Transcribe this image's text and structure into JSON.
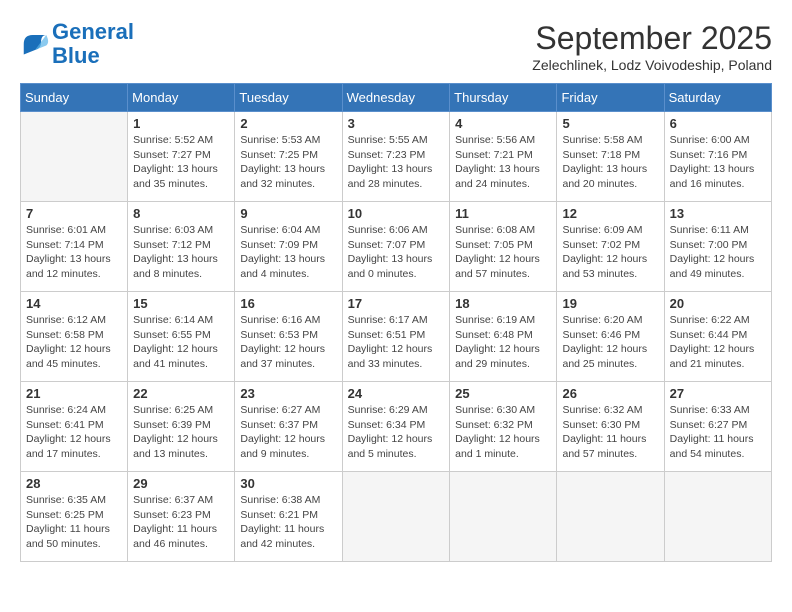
{
  "header": {
    "logo_line1": "General",
    "logo_line2": "Blue",
    "month": "September 2025",
    "location": "Zelechlinek, Lodz Voivodeship, Poland"
  },
  "days_of_week": [
    "Sunday",
    "Monday",
    "Tuesday",
    "Wednesday",
    "Thursday",
    "Friday",
    "Saturday"
  ],
  "weeks": [
    [
      {
        "day": "",
        "info": ""
      },
      {
        "day": "1",
        "info": "Sunrise: 5:52 AM\nSunset: 7:27 PM\nDaylight: 13 hours\nand 35 minutes."
      },
      {
        "day": "2",
        "info": "Sunrise: 5:53 AM\nSunset: 7:25 PM\nDaylight: 13 hours\nand 32 minutes."
      },
      {
        "day": "3",
        "info": "Sunrise: 5:55 AM\nSunset: 7:23 PM\nDaylight: 13 hours\nand 28 minutes."
      },
      {
        "day": "4",
        "info": "Sunrise: 5:56 AM\nSunset: 7:21 PM\nDaylight: 13 hours\nand 24 minutes."
      },
      {
        "day": "5",
        "info": "Sunrise: 5:58 AM\nSunset: 7:18 PM\nDaylight: 13 hours\nand 20 minutes."
      },
      {
        "day": "6",
        "info": "Sunrise: 6:00 AM\nSunset: 7:16 PM\nDaylight: 13 hours\nand 16 minutes."
      }
    ],
    [
      {
        "day": "7",
        "info": "Sunrise: 6:01 AM\nSunset: 7:14 PM\nDaylight: 13 hours\nand 12 minutes."
      },
      {
        "day": "8",
        "info": "Sunrise: 6:03 AM\nSunset: 7:12 PM\nDaylight: 13 hours\nand 8 minutes."
      },
      {
        "day": "9",
        "info": "Sunrise: 6:04 AM\nSunset: 7:09 PM\nDaylight: 13 hours\nand 4 minutes."
      },
      {
        "day": "10",
        "info": "Sunrise: 6:06 AM\nSunset: 7:07 PM\nDaylight: 13 hours\nand 0 minutes."
      },
      {
        "day": "11",
        "info": "Sunrise: 6:08 AM\nSunset: 7:05 PM\nDaylight: 12 hours\nand 57 minutes."
      },
      {
        "day": "12",
        "info": "Sunrise: 6:09 AM\nSunset: 7:02 PM\nDaylight: 12 hours\nand 53 minutes."
      },
      {
        "day": "13",
        "info": "Sunrise: 6:11 AM\nSunset: 7:00 PM\nDaylight: 12 hours\nand 49 minutes."
      }
    ],
    [
      {
        "day": "14",
        "info": "Sunrise: 6:12 AM\nSunset: 6:58 PM\nDaylight: 12 hours\nand 45 minutes."
      },
      {
        "day": "15",
        "info": "Sunrise: 6:14 AM\nSunset: 6:55 PM\nDaylight: 12 hours\nand 41 minutes."
      },
      {
        "day": "16",
        "info": "Sunrise: 6:16 AM\nSunset: 6:53 PM\nDaylight: 12 hours\nand 37 minutes."
      },
      {
        "day": "17",
        "info": "Sunrise: 6:17 AM\nSunset: 6:51 PM\nDaylight: 12 hours\nand 33 minutes."
      },
      {
        "day": "18",
        "info": "Sunrise: 6:19 AM\nSunset: 6:48 PM\nDaylight: 12 hours\nand 29 minutes."
      },
      {
        "day": "19",
        "info": "Sunrise: 6:20 AM\nSunset: 6:46 PM\nDaylight: 12 hours\nand 25 minutes."
      },
      {
        "day": "20",
        "info": "Sunrise: 6:22 AM\nSunset: 6:44 PM\nDaylight: 12 hours\nand 21 minutes."
      }
    ],
    [
      {
        "day": "21",
        "info": "Sunrise: 6:24 AM\nSunset: 6:41 PM\nDaylight: 12 hours\nand 17 minutes."
      },
      {
        "day": "22",
        "info": "Sunrise: 6:25 AM\nSunset: 6:39 PM\nDaylight: 12 hours\nand 13 minutes."
      },
      {
        "day": "23",
        "info": "Sunrise: 6:27 AM\nSunset: 6:37 PM\nDaylight: 12 hours\nand 9 minutes."
      },
      {
        "day": "24",
        "info": "Sunrise: 6:29 AM\nSunset: 6:34 PM\nDaylight: 12 hours\nand 5 minutes."
      },
      {
        "day": "25",
        "info": "Sunrise: 6:30 AM\nSunset: 6:32 PM\nDaylight: 12 hours\nand 1 minute."
      },
      {
        "day": "26",
        "info": "Sunrise: 6:32 AM\nSunset: 6:30 PM\nDaylight: 11 hours\nand 57 minutes."
      },
      {
        "day": "27",
        "info": "Sunrise: 6:33 AM\nSunset: 6:27 PM\nDaylight: 11 hours\nand 54 minutes."
      }
    ],
    [
      {
        "day": "28",
        "info": "Sunrise: 6:35 AM\nSunset: 6:25 PM\nDaylight: 11 hours\nand 50 minutes."
      },
      {
        "day": "29",
        "info": "Sunrise: 6:37 AM\nSunset: 6:23 PM\nDaylight: 11 hours\nand 46 minutes."
      },
      {
        "day": "30",
        "info": "Sunrise: 6:38 AM\nSunset: 6:21 PM\nDaylight: 11 hours\nand 42 minutes."
      },
      {
        "day": "",
        "info": ""
      },
      {
        "day": "",
        "info": ""
      },
      {
        "day": "",
        "info": ""
      },
      {
        "day": "",
        "info": ""
      }
    ]
  ]
}
